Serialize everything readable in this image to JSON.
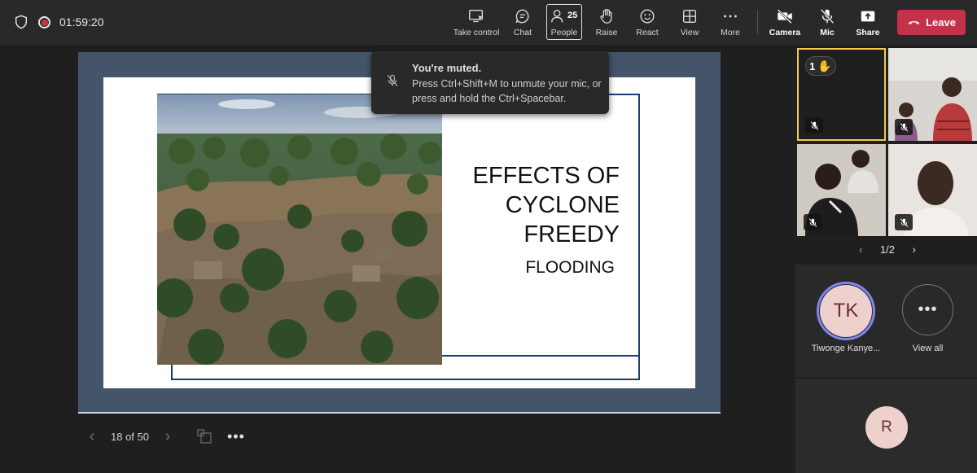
{
  "header": {
    "timer": "01:59:20",
    "buttons": [
      {
        "label": "Take control",
        "icon": "take-control-icon"
      },
      {
        "label": "Chat",
        "icon": "chat-icon"
      },
      {
        "label": "People",
        "icon": "people-icon",
        "count": "25"
      },
      {
        "label": "Raise",
        "icon": "raise-hand-icon"
      },
      {
        "label": "React",
        "icon": "react-icon"
      },
      {
        "label": "View",
        "icon": "view-icon"
      },
      {
        "label": "More",
        "icon": "more-icon"
      },
      {
        "label": "Camera",
        "icon": "camera-off-icon"
      },
      {
        "label": "Mic",
        "icon": "mic-off-icon"
      },
      {
        "label": "Share",
        "icon": "share-icon"
      }
    ],
    "leave_label": "Leave",
    "leave_color": "#c4314b"
  },
  "toast": {
    "title": "You're muted.",
    "body": "Press Ctrl+Shift+M to unmute your mic, or press and hold the Ctrl+Spacebar."
  },
  "slide": {
    "title": "EFFECTS OF CYCLONE FREEDY",
    "subtitle": "FLOODING",
    "border_color": "#1f3b6e",
    "stage_color": "#44546a"
  },
  "slide_nav": {
    "counter": "18 of 50"
  },
  "participants": {
    "raised_hand_count": "1",
    "raised_hand_emoji": "✋",
    "highlight_color": "#f2c94c",
    "pager": "1/2",
    "roster": [
      {
        "initials": "TK",
        "name": "Tiwonge Kanye..."
      }
    ],
    "view_all_label": "View all",
    "bottom_initials": "R",
    "avatar_color": "#eed0cc",
    "speaker_ring_color": "#7f85f5"
  }
}
